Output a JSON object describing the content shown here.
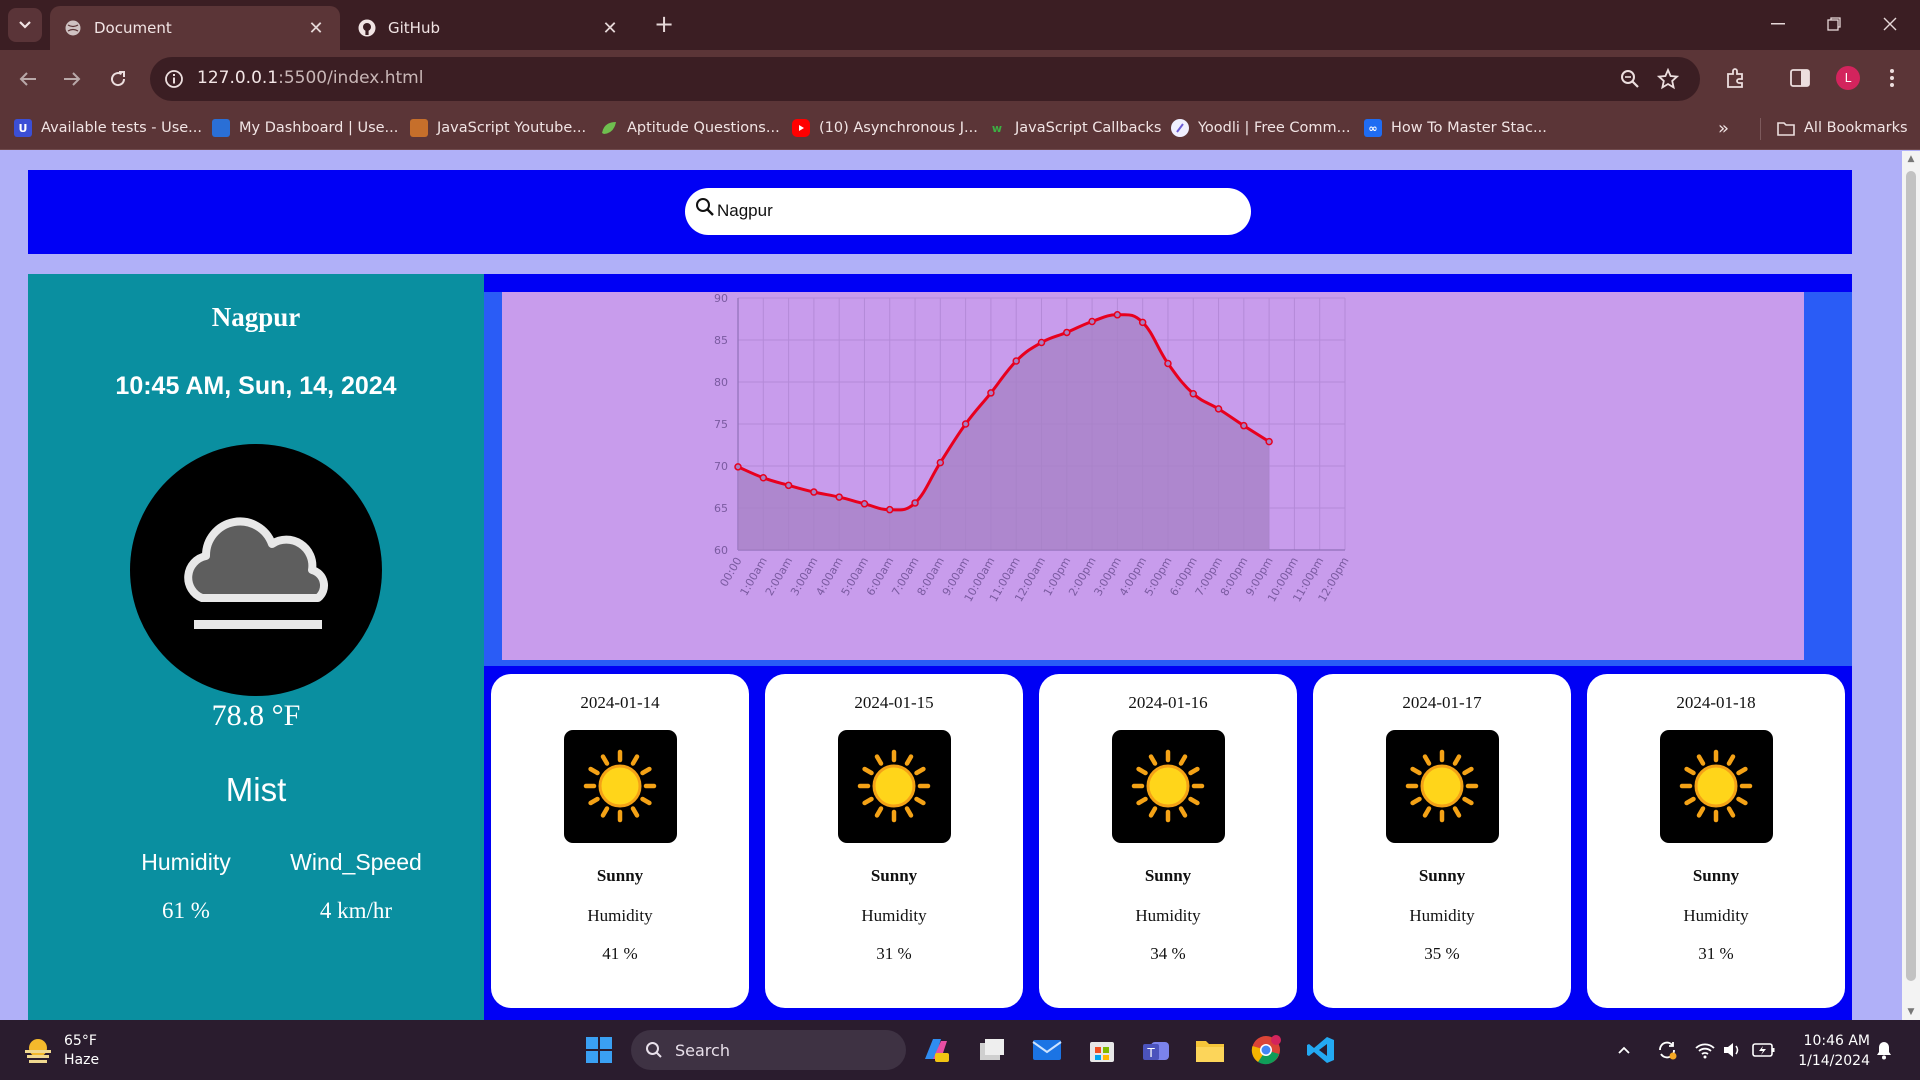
{
  "browser": {
    "tabs": [
      {
        "title": "Document",
        "active": true
      },
      {
        "title": "GitHub",
        "active": false
      }
    ],
    "url_host": "127.0.0.1",
    "url_rest": ":5500/index.html",
    "bookmarks": [
      "Available tests - Use...",
      "My Dashboard | Use...",
      "JavaScript Youtube...",
      "Aptitude Questions...",
      "(10) Asynchronous J...",
      "JavaScript Callbacks",
      "Yoodli | Free Comm...",
      "How To Master Stac..."
    ],
    "all_bookmarks": "All Bookmarks",
    "avatar_letter": "L"
  },
  "search": {
    "value": "Nagpur"
  },
  "current": {
    "city": "Nagpur",
    "datetime": "10:45 AM, Sun, 14, 2024",
    "temperature": "78.8 °F",
    "condition": "Mist",
    "humidity_label": "Humidity",
    "humidity_value": "61 %",
    "wind_label": "Wind_Speed",
    "wind_value": "4 km/hr",
    "icon": "fog-cloud-icon"
  },
  "chart_data": {
    "type": "line",
    "title": "",
    "xlabel": "",
    "ylabel": "",
    "ylim": [
      60,
      90
    ],
    "y_ticks": [
      60,
      65,
      70,
      75,
      80,
      85,
      90
    ],
    "categories": [
      "00:00",
      "1:00am",
      "2:00am",
      "3:00am",
      "4:00am",
      "5:00am",
      "6:00am",
      "7:00am",
      "8:00am",
      "9:00am",
      "10:00am",
      "11:00am",
      "12:00am",
      "1:00pm",
      "2:00pm",
      "3:00pm",
      "4:00pm",
      "5:00pm",
      "6:00pm",
      "7:00pm",
      "8:00pm",
      "9:00pm",
      "10:00pm",
      "11:00pm",
      "12:00pm"
    ],
    "series": [
      {
        "values": [
          69.9,
          68.6,
          67.7,
          66.9,
          66.3,
          65.5,
          64.8,
          65.6,
          70.4,
          75.0,
          78.7,
          82.5,
          84.7,
          85.9,
          87.2,
          88.0,
          87.1,
          82.2,
          78.6,
          76.8,
          74.8,
          72.9
        ]
      }
    ],
    "colors": {
      "line": "#e8001e",
      "fill": "#a580c4",
      "grid": "#b48ad8",
      "background": "#c89cec"
    },
    "grid": true,
    "legend": "none"
  },
  "forecast": [
    {
      "date": "2024-01-14",
      "condition": "Sunny",
      "humidity_label": "Humidity",
      "humidity": "41 %"
    },
    {
      "date": "2024-01-15",
      "condition": "Sunny",
      "humidity_label": "Humidity",
      "humidity": "31 %"
    },
    {
      "date": "2024-01-16",
      "condition": "Sunny",
      "humidity_label": "Humidity",
      "humidity": "34 %"
    },
    {
      "date": "2024-01-17",
      "condition": "Sunny",
      "humidity_label": "Humidity",
      "humidity": "35 %"
    },
    {
      "date": "2024-01-18",
      "condition": "Sunny",
      "humidity_label": "Humidity",
      "humidity": "31 %"
    }
  ],
  "taskbar": {
    "weather_temp": "65°F",
    "weather_desc": "Haze",
    "search_label": "Search",
    "time": "10:46 AM",
    "date": "1/14/2024"
  },
  "theme": {
    "header_blue": "#0000f5",
    "panel_teal": "#0a8fa0",
    "page_bg": "#b0b0f8",
    "chart_bg": "#c89cec"
  }
}
